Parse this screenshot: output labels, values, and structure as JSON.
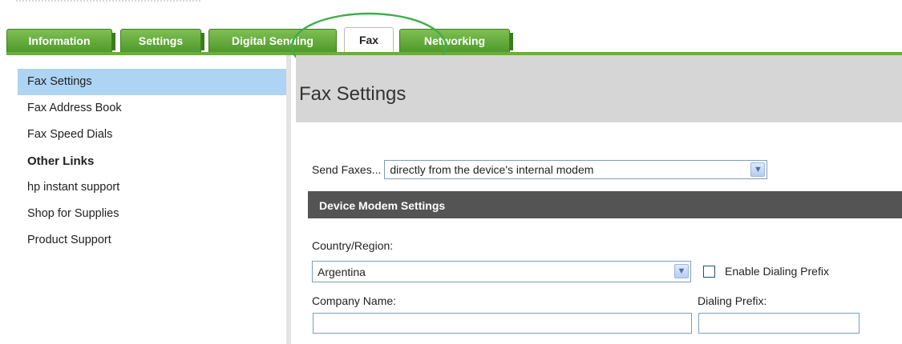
{
  "tabs": [
    {
      "label": "Information",
      "active": false
    },
    {
      "label": "Settings",
      "active": false
    },
    {
      "label": "Digital Sending",
      "active": false
    },
    {
      "label": "Fax",
      "active": true
    },
    {
      "label": "Networking",
      "active": false
    }
  ],
  "sidebar": {
    "items": [
      {
        "label": "Fax Settings",
        "active": true
      },
      {
        "label": "Fax Address Book"
      },
      {
        "label": "Fax Speed Dials"
      }
    ],
    "other_links_heading": "Other Links",
    "links": [
      {
        "label": "hp instant support"
      },
      {
        "label": "Shop for Supplies"
      },
      {
        "label": "Product Support"
      }
    ]
  },
  "main": {
    "title": "Fax Settings",
    "send_faxes_label": "Send Faxes...",
    "send_faxes_value": "directly from the device's internal modem",
    "section_title": "Device Modem Settings",
    "country_label": "Country/Region:",
    "country_value": "Argentina",
    "enable_prefix_label": "Enable Dialing Prefix",
    "company_name_label": "Company Name:",
    "company_name_value": "",
    "dialing_prefix_label": "Dialing Prefix:",
    "dialing_prefix_value": ""
  },
  "colors": {
    "tab_green": "#5aa533",
    "active_sidebar": "#aed4f4",
    "section_bar": "#545454",
    "annotation": "#3fae49"
  },
  "icons": {
    "dropdown": "chevron-down-icon"
  }
}
